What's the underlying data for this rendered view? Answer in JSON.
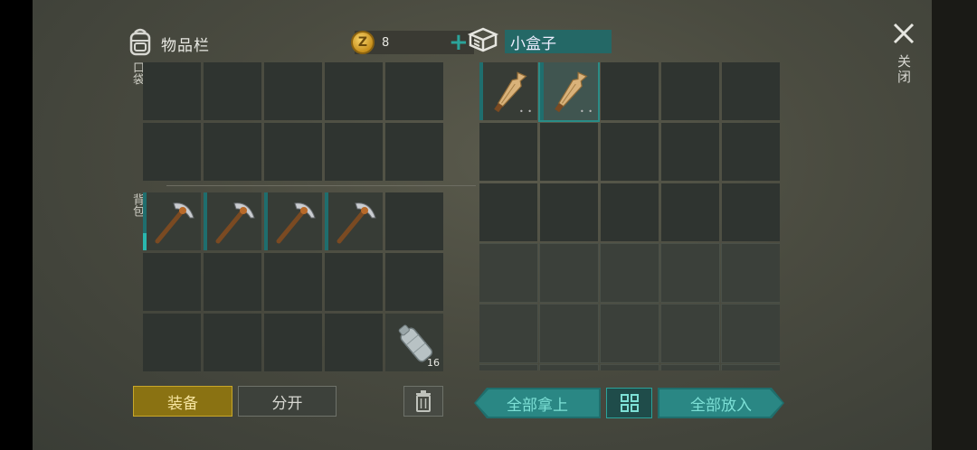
{
  "inventory": {
    "title": "物品栏",
    "coins": "8",
    "coin_symbol": "Z",
    "pocket_label": "口袋",
    "backpack_label": "背包",
    "pickaxe_icon": "pickaxe-icon",
    "bottle_count": "16"
  },
  "buttons": {
    "equip": "装备",
    "split": "分开",
    "take_all": "全部拿上",
    "put_all": "全部放入"
  },
  "container": {
    "title": "小盒子",
    "item_icon": "broken-plank-icon"
  },
  "close_label": "关闭",
  "colors": {
    "accent_teal": "#2ba39a",
    "equip_gold": "#c8a72a"
  }
}
